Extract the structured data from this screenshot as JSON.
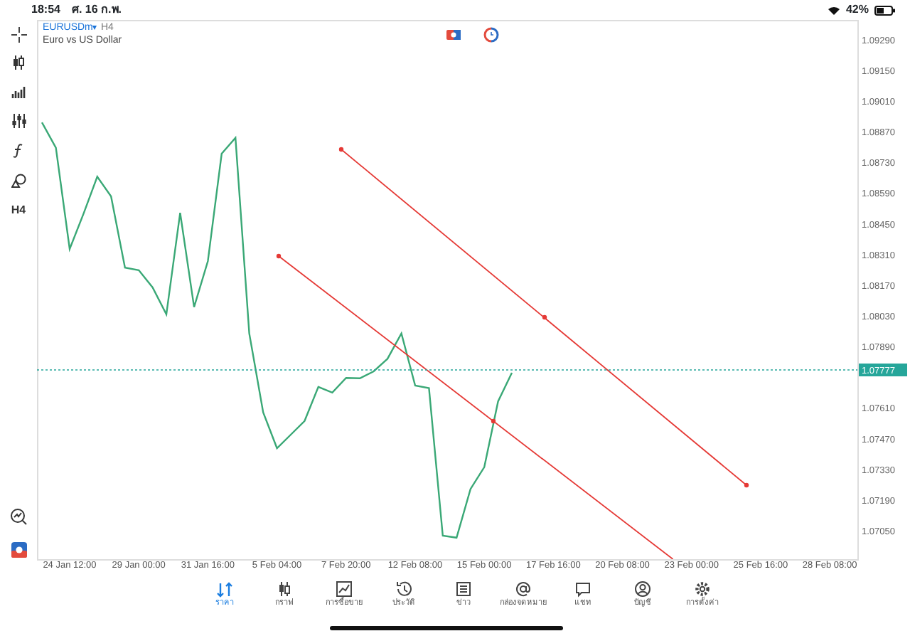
{
  "status_bar": {
    "time": "18:54",
    "date": "ศ. 16 ก.พ.",
    "battery": "42%"
  },
  "toolbar": {
    "timeframe_button": "H4"
  },
  "chart": {
    "symbol": "EURUSDm",
    "dropdown": "▾",
    "timeframe": "H4",
    "description": "Euro vs US Dollar",
    "chart_data": {
      "type": "line",
      "ylim": [
        1.0692,
        1.0938
      ],
      "categories": [
        null,
        null,
        "24 Jan 12:00",
        null,
        null,
        null,
        null,
        "29 Jan 00:00",
        null,
        null,
        null,
        null,
        "31 Jan 16:00",
        null,
        null,
        null,
        null,
        "5 Feb 04:00",
        null,
        null,
        null,
        null,
        "7 Feb 20:00",
        null,
        null,
        null,
        null,
        "12 Feb 08:00",
        null,
        null,
        null,
        null,
        "15 Feb 00:00",
        null,
        null,
        null,
        null,
        "17 Feb 16:00",
        null,
        null,
        null,
        null,
        "20 Feb 08:00",
        null,
        null,
        null,
        null,
        "23 Feb 00:00",
        null,
        null,
        null,
        null,
        "25 Feb 16:00",
        null,
        null,
        null,
        null,
        "28 Feb 08:00",
        null,
        null
      ],
      "yticks": [
        {
          "value": 1.0929,
          "label": "1.09290"
        },
        {
          "value": 1.0915,
          "label": "1.09150"
        },
        {
          "value": 1.0901,
          "label": "1.09010"
        },
        {
          "value": 1.0887,
          "label": "1.08870"
        },
        {
          "value": 1.0873,
          "label": "1.08730"
        },
        {
          "value": 1.0859,
          "label": "1.08590"
        },
        {
          "value": 1.0845,
          "label": "1.08450"
        },
        {
          "value": 1.0831,
          "label": "1.08310"
        },
        {
          "value": 1.0817,
          "label": "1.08170"
        },
        {
          "value": 1.0803,
          "label": "1.08030"
        },
        {
          "value": 1.0789,
          "label": "1.07890"
        },
        {
          "value": 1.0761,
          "label": "1.07610"
        },
        {
          "value": 1.0747,
          "label": "1.07470"
        },
        {
          "value": 1.0733,
          "label": "1.07330"
        },
        {
          "value": 1.0719,
          "label": "1.07190"
        },
        {
          "value": 1.0705,
          "label": "1.07050"
        }
      ],
      "series": [
        {
          "color": "#3aa876",
          "values": [
            1.08912,
            1.08797,
            1.08335,
            1.08495,
            1.08665,
            1.08575,
            1.0825,
            1.08238,
            1.0816,
            1.08037,
            1.085,
            1.0807,
            1.0828,
            1.0877,
            1.08842,
            1.0795,
            1.0759,
            1.07426,
            1.07488,
            1.0755,
            1.07706,
            1.0768,
            1.07747,
            1.07745,
            1.07777,
            1.07834,
            1.0795,
            1.07712,
            1.077,
            1.07027,
            1.07018,
            1.0724,
            1.0734,
            1.0764,
            1.0777,
            null,
            null,
            null,
            null,
            null,
            null,
            null,
            null,
            null,
            null,
            null,
            null,
            null,
            null,
            null,
            null,
            null,
            null,
            null,
            null,
            null,
            null,
            null,
            null,
            null
          ]
        }
      ]
    },
    "current_price": "1.07777"
  },
  "tabs": [
    {
      "label": "ราคา",
      "selected": true
    },
    {
      "label": "กราฟ",
      "selected": false
    },
    {
      "label": "การซื้อขาย",
      "selected": false
    },
    {
      "label": "ประวัติ",
      "selected": false
    },
    {
      "label": "ข่าว",
      "selected": false
    },
    {
      "label": "กล่องจดหมาย",
      "selected": false
    },
    {
      "label": "แชท",
      "selected": false
    },
    {
      "label": "บัญชี",
      "selected": false
    },
    {
      "label": "การตั้งค่า",
      "selected": false
    }
  ]
}
